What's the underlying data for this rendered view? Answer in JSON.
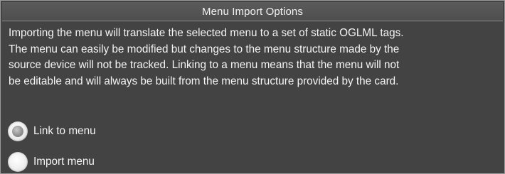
{
  "dialog": {
    "title": "Menu Import Options",
    "description_lines": [
      "Importing the menu will translate the selected menu to a set of static OGLML tags.",
      "The menu can easily be modified but changes to the menu structure made by the",
      "source device will not be tracked.  Linking to a menu means that the menu will not",
      "be editable and will always be built from the menu structure provided by the card."
    ]
  },
  "options": {
    "link": {
      "label": "Link to menu",
      "selected": true
    },
    "import": {
      "label": "Import menu",
      "selected": false
    }
  },
  "colors": {
    "background": "#434343",
    "titlebar": "#555555",
    "text": "#f4f4f4"
  }
}
